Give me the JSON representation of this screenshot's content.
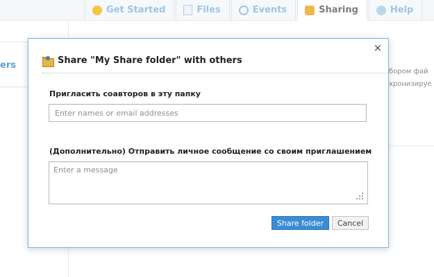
{
  "tabs": [
    {
      "label": "Get Started",
      "icon": "smile-icon"
    },
    {
      "label": "Files",
      "icon": "files-icon"
    },
    {
      "label": "Events",
      "icon": "clock-icon"
    },
    {
      "label": "Sharing",
      "icon": "share-icon"
    },
    {
      "label": "Help",
      "icon": "help-icon"
    }
  ],
  "background": {
    "left_tab_label": "ers",
    "right_text_1": "бором фай",
    "right_text_2": "хронизируе"
  },
  "dialog": {
    "title": "Share \"My Share folder\" with others",
    "invite_label": "Пригласить соавторов в эту папку",
    "invite_placeholder": "Enter names or email addresses",
    "message_label": "(Дополнительно) Отправить личное сообщение со своим приглашением",
    "message_placeholder": "Enter a message",
    "share_button": "Share folder",
    "cancel_button": "Cancel",
    "close_symbol": "×"
  },
  "colors": {
    "accent": "#3a8dd4",
    "dialog_border": "#7fb1d9",
    "tab_inactive_text": "#9ec4e3"
  }
}
